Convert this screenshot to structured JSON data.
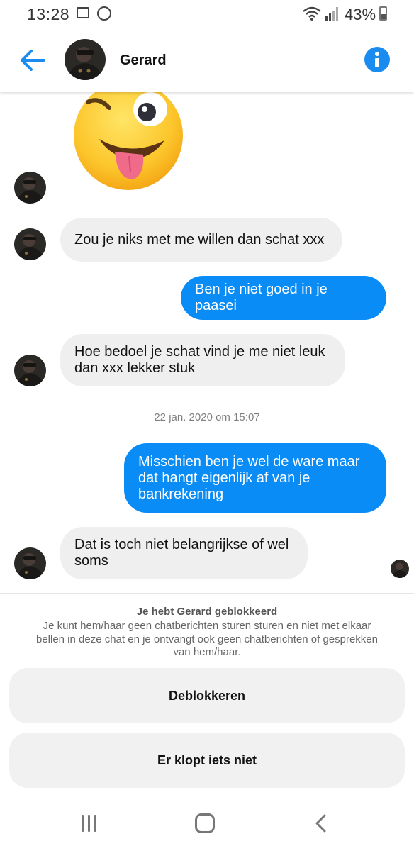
{
  "status_bar": {
    "time": "13:28",
    "battery": "43%",
    "battery_level": 0.43
  },
  "header": {
    "contact_name": "Gerard"
  },
  "messages": [
    {
      "direction": "in",
      "text": "Zou je niks met me willen dan schat xxx"
    },
    {
      "direction": "out",
      "text": "Ben je niet goed in je paasei"
    },
    {
      "direction": "in",
      "lines": [
        "Hoe bedoel je schat vind je me niet leuk",
        "dan xxx lekker stuk"
      ]
    },
    {
      "direction": "out",
      "lines": [
        "Misschien ben je wel de ware maar",
        "dat hangt eigenlijk af van je",
        "bankrekening"
      ]
    },
    {
      "direction": "in",
      "lines": [
        "Dat is toch niet belangrijkse of wel",
        "soms"
      ]
    }
  ],
  "timestamp": "22 jan. 2020 om 15:07",
  "block_panel": {
    "title": "Je hebt Gerard geblokkeerd",
    "description": "Je kunt hem/haar geen chatberichten sturen sturen en niet met elkaar bellen in deze chat en je ontvangt ook geen chatberichten of gesprekken van hem/haar.",
    "unblock_label": "Deblokkeren",
    "report_label": "Er klopt iets niet"
  },
  "icons": {
    "back": "arrow-left-icon",
    "info": "info-icon",
    "emoji": "winking-face-with-tongue-emoji",
    "nav_recents": "recents-icon",
    "nav_home": "home-icon",
    "nav_back": "chevron-left-icon"
  },
  "colors": {
    "accent": "#0a8cf6",
    "incoming_bubble": "#efefef",
    "panel_button": "#f1f1f1"
  }
}
